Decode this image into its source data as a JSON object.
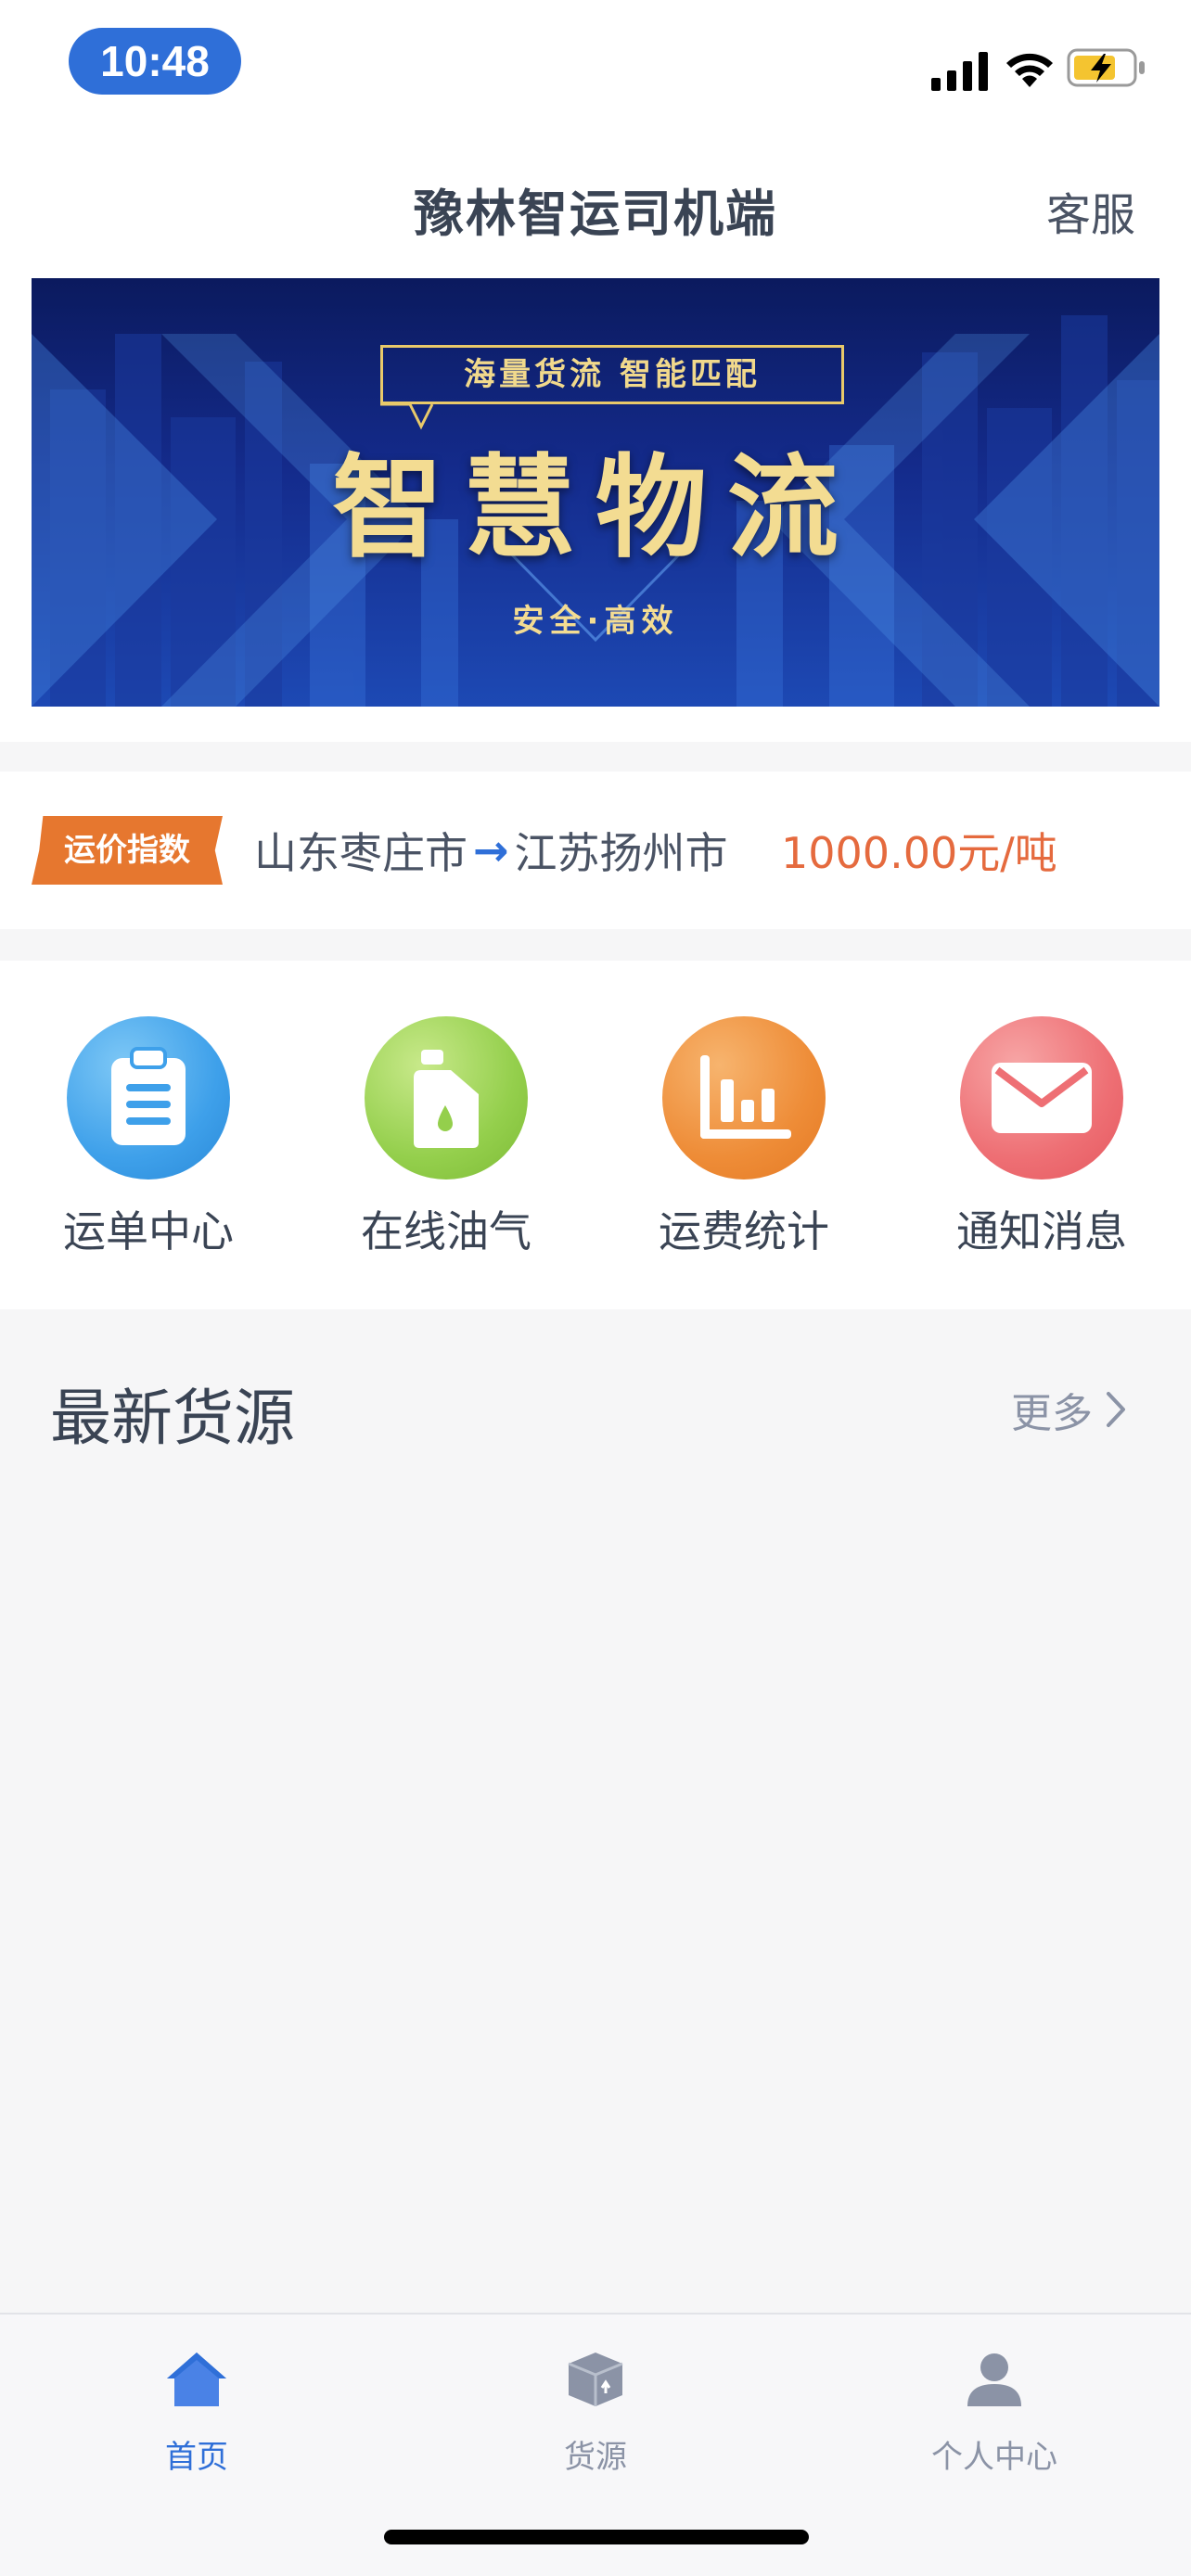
{
  "status_bar": {
    "time": "10:48"
  },
  "header": {
    "title": "豫林智运司机端",
    "service_label": "客服"
  },
  "banner": {
    "tagline": "海量货流 智能匹配",
    "headline": "智慧物流",
    "sub": "安全·高效"
  },
  "freight_index": {
    "badge": "运价指数",
    "origin": "山东枣庄市",
    "arrow": "→",
    "destination": "江苏扬州市",
    "price": "1000.00元/吨"
  },
  "quick_actions": [
    {
      "label": "运单中心",
      "icon": "clipboard-icon",
      "color": "#3ea0ea"
    },
    {
      "label": "在线油气",
      "icon": "fuel-can-icon",
      "color": "#94cf4c"
    },
    {
      "label": "运费统计",
      "icon": "bar-chart-icon",
      "color": "#ee8c37"
    },
    {
      "label": "通知消息",
      "icon": "envelope-icon",
      "color": "#ee6f74"
    }
  ],
  "latest": {
    "title": "最新货源",
    "more": "更多"
  },
  "tabs": [
    {
      "label": "首页",
      "icon": "home-icon",
      "active": true
    },
    {
      "label": "货源",
      "icon": "cargo-box-icon",
      "active": false
    },
    {
      "label": "个人中心",
      "icon": "person-icon",
      "active": false
    }
  ],
  "colors": {
    "accent": "#2f6fd8",
    "price": "#e56a3e",
    "badge": "#e6772f"
  }
}
